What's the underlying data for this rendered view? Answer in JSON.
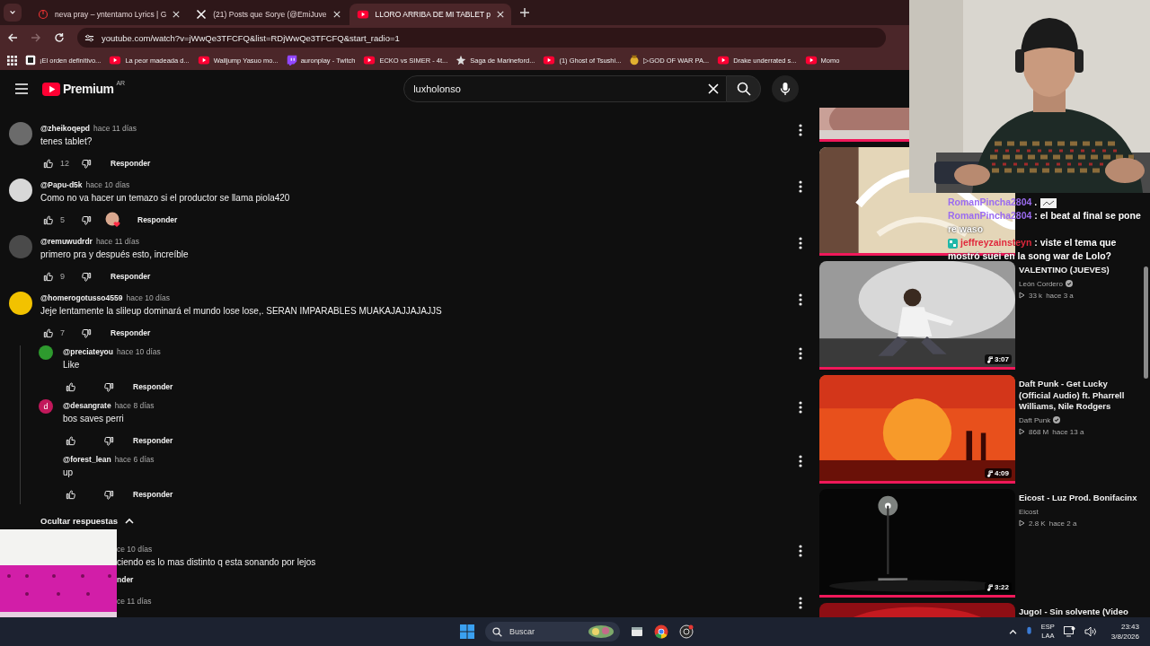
{
  "browser": {
    "tabs": [
      {
        "title": "neva pray – yntentamo Lyrics | G",
        "kind": "site",
        "selected": false
      },
      {
        "title": "(21) Posts que Sorye (@EmiJuve",
        "kind": "x",
        "selected": false
      },
      {
        "title": "LLORO ARRIBA DE MI TABLET p",
        "kind": "youtube",
        "selected": true
      }
    ],
    "address": "youtube.com/watch?v=jWwQe3TFCFQ&list=RDjWwQe3TFCFQ&start_radio=1",
    "bookmarks": [
      {
        "label": "¡El orden definitivo...",
        "kind": "page"
      },
      {
        "label": "La peor madeada d...",
        "kind": "youtube"
      },
      {
        "label": "Walljump Yasuo mo...",
        "kind": "youtube"
      },
      {
        "label": "auronplay - Twitch",
        "kind": "twitch"
      },
      {
        "label": "ECKO vs SIMER - 4t...",
        "kind": "youtube"
      },
      {
        "label": "Saga de Marineford...",
        "kind": "star"
      },
      {
        "label": "(1) Ghost of Tsushi...",
        "kind": "youtube"
      },
      {
        "label": "▷GOD OF WAR PA...",
        "kind": "medal"
      },
      {
        "label": "Drake underrated s...",
        "kind": "youtube"
      },
      {
        "label": "Momo",
        "kind": "youtube"
      }
    ]
  },
  "header": {
    "logo": "Premium",
    "region": "AR",
    "search": {
      "value": "luxholonso"
    }
  },
  "comments": [
    {
      "author": "@zheikoqepd",
      "time": "hace 11 días",
      "text": "tenes tablet?",
      "likes": "12",
      "reply": "Responder",
      "avatar": {
        "color": "#6b6b6b"
      },
      "creator_heart": false
    },
    {
      "author": "@Papu-d5k",
      "time": "hace 10 días",
      "text": "Como no va hacer un temazo si el productor se llama piola420",
      "likes": "5",
      "reply": "Responder",
      "avatar": {
        "color": "#d8d8d8"
      },
      "creator_heart": true
    },
    {
      "author": "@remuwudrdr",
      "time": "hace 11 días",
      "text": "primero pra y después esto, increíble",
      "likes": "9",
      "reply": "Responder",
      "avatar": {
        "color": "#4a4a4a"
      },
      "creator_heart": false
    },
    {
      "author": "@homerogotusso4559",
      "time": "hace 10 días",
      "text": "Jeje lentamente la slileup dominará el mundo lose lose,. SERAN IMPARABLES MUAKAJAJJAJAJJS",
      "likes": "7",
      "reply": "Responder",
      "avatar": {
        "color": "#f2c200"
      },
      "creator_heart": false,
      "replies": [
        {
          "author": "@preciateyou",
          "time": "hace 10 días",
          "text": "Like",
          "reply": "Responder",
          "avatar": {
            "color": "#2e9a2e"
          }
        },
        {
          "author": "@desangrate",
          "time": "hace 8 días",
          "text": "bos saves perri",
          "reply": "Responder",
          "avatar": {
            "color": "#c2185b",
            "initial": "d"
          }
        },
        {
          "author": "@forest_lean",
          "time": "hace 6 días",
          "text": "up",
          "reply": "Responder"
        }
      ],
      "hide_replies": "Ocultar respuestas"
    }
  ],
  "partial_comments": [
    {
      "time": "ce 10 días",
      "text": "ciendo es lo mas distinto q esta sonando por lejos",
      "reply": "nder"
    },
    {
      "time": "ce 11 días"
    }
  ],
  "videos": [
    {
      "level": 1
    },
    {
      "level": 1
    },
    {
      "title": "VALENTINO (JUEVES)",
      "channel": "León Cordero",
      "verified": true,
      "views": "33 k",
      "age": "hace 3 a",
      "duration": "3:07",
      "level": 1
    },
    {
      "title": "Daft Punk - Get Lucky (Official Audio) ft. Pharrell Williams, Nile Rodgers",
      "channel": "Daft Punk",
      "verified": true,
      "views": "868 M",
      "age": "hace 13 a",
      "duration": "4:09",
      "level": 1
    },
    {
      "title": "Eicost - Luz Prod. Bonifacinx",
      "channel": "Eicost",
      "verified": false,
      "views": "2.8 K",
      "age": "hace 2 a",
      "duration": "3:22",
      "level": 1
    },
    {
      "title": "Jugo! - Sin solvente (Video"
    }
  ],
  "chat": [
    {
      "user": "RomanPincha2804",
      "color": "#9b6cf0",
      "text": " .",
      "emote": true
    },
    {
      "user": "RomanPincha2804",
      "color": "#9b6cf0",
      "text": " : el beat al final se pone re waso"
    },
    {
      "user": "jeffreyzainsteyn",
      "color": "#e0283c",
      "text": " : viste el tema que mostró suei en la song war de Lolo?",
      "badge": true
    }
  ],
  "taskbar": {
    "search": "Buscar",
    "lang_top": "ESP",
    "lang_bottom": "LAA",
    "time": "23:43",
    "date": "3/8/2026"
  }
}
